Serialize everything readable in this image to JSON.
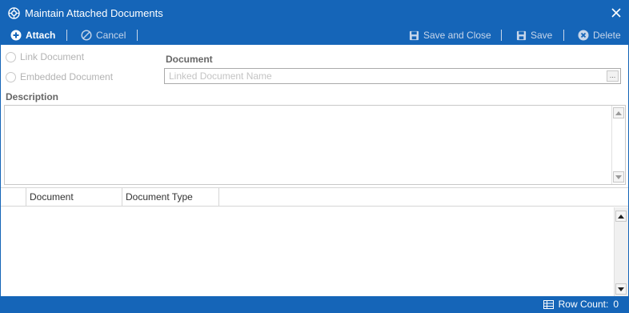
{
  "window": {
    "title": "Maintain Attached Documents"
  },
  "toolbar": {
    "attach_label": "Attach",
    "cancel_label": "Cancel",
    "save_close_label": "Save and Close",
    "save_label": "Save",
    "delete_label": "Delete"
  },
  "form": {
    "link_document_label": "Link Document",
    "embedded_document_label": "Embedded Document",
    "document_label": "Document",
    "document_placeholder": "Linked Document Name",
    "document_value": "",
    "description_label": "Description",
    "description_value": "",
    "browse_label": "..."
  },
  "grid": {
    "columns": [
      "Document",
      "Document Type"
    ],
    "rows": []
  },
  "status": {
    "row_count_label": "Row Count:",
    "row_count": "0"
  },
  "colors": {
    "accent": "#1565b8",
    "toolbar_text": "#ffffff",
    "disabled_text": "#c7d6ea"
  }
}
